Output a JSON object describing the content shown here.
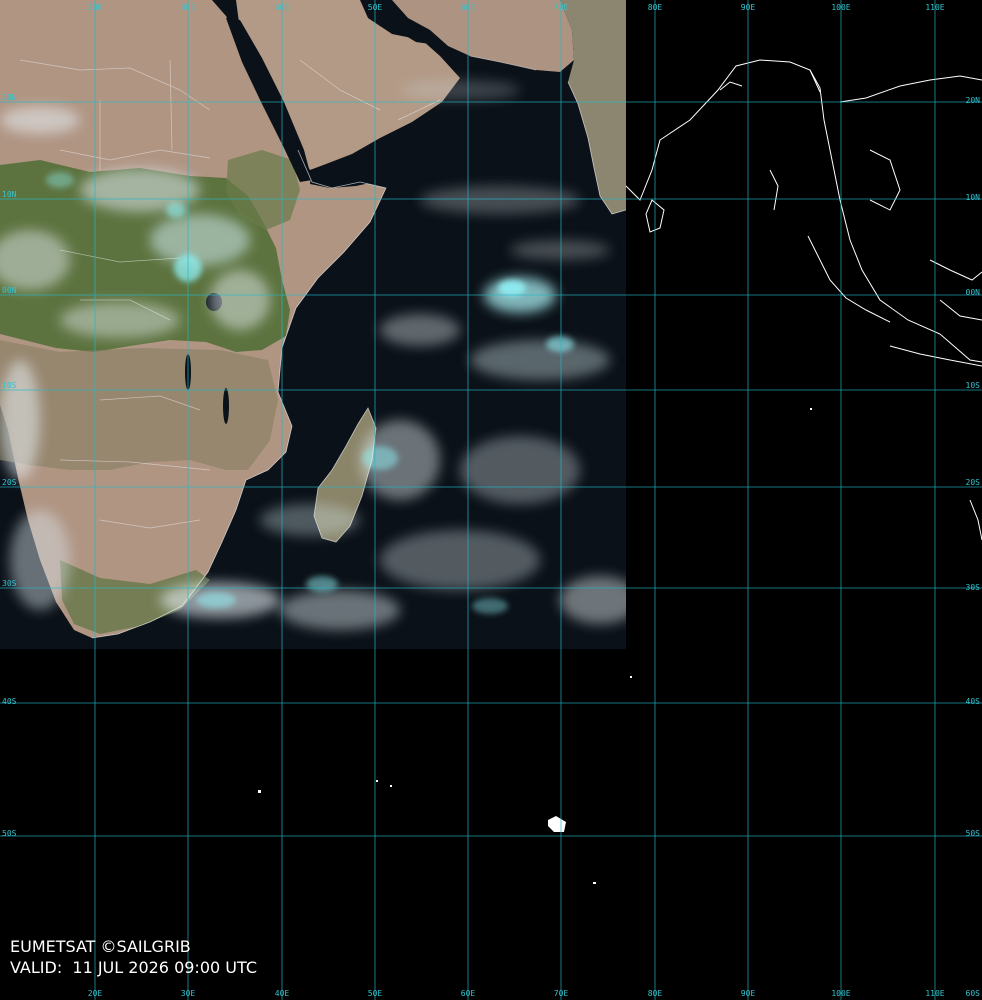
{
  "map": {
    "source": "EUMETSAT ©SAILGRIB",
    "valid_label": "VALID:",
    "valid_time": "11 JUL 2026 09:00 UTC",
    "colors": {
      "ocean": "#0b1118",
      "desert": "#b59a82",
      "vegetation": "#58703c",
      "savanna": "#8f8567",
      "cloud": "#e8f0f5",
      "cloud_cyan": "#7fe6ee",
      "grid": "#23b8c8",
      "grid_label": "#31c4d0",
      "coastline": "#ffffff",
      "background": "#000000"
    },
    "longitude_labels": [
      "20E",
      "30E",
      "40E",
      "50E",
      "60E",
      "70E",
      "80E",
      "90E",
      "100E",
      "110E"
    ],
    "latitude_labels_left": [
      "20N",
      "10N",
      "00N",
      "10S",
      "20S",
      "30S",
      "40S",
      "50S"
    ],
    "latitude_labels_right": [
      "20N",
      "10N",
      "00N",
      "10S",
      "20S",
      "30S",
      "40S",
      "50S",
      "60S"
    ]
  }
}
